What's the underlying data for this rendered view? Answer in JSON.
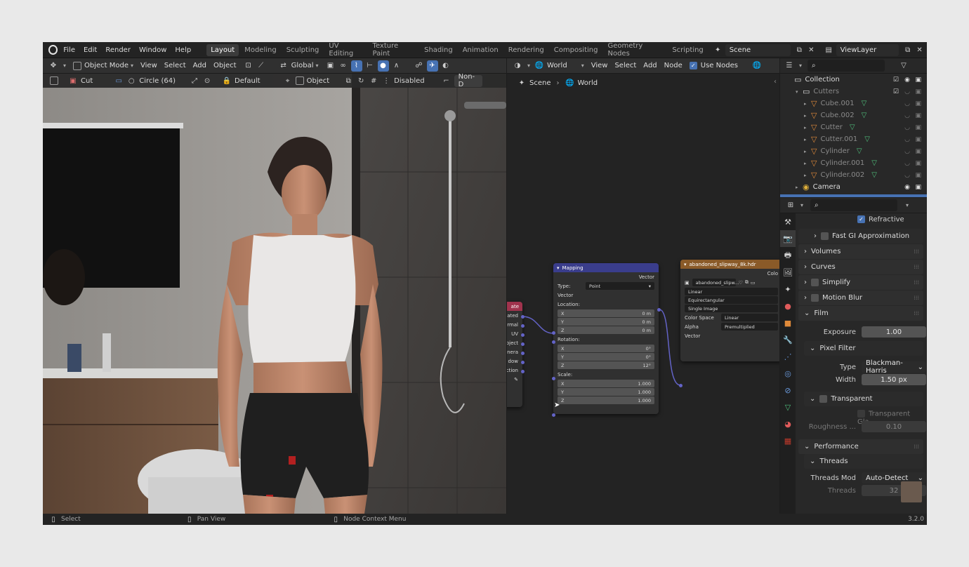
{
  "menu": [
    "File",
    "Edit",
    "Render",
    "Window",
    "Help"
  ],
  "workspaces": [
    {
      "label": "Layout",
      "active": true
    },
    {
      "label": "Modeling"
    },
    {
      "label": "Sculpting"
    },
    {
      "label": "UV Editing"
    },
    {
      "label": "Texture Paint"
    },
    {
      "label": "Shading"
    },
    {
      "label": "Animation"
    },
    {
      "label": "Rendering"
    },
    {
      "label": "Compositing"
    },
    {
      "label": "Geometry Nodes"
    },
    {
      "label": "Scripting"
    }
  ],
  "scene_name": "Scene",
  "view_layer": "ViewLayer",
  "viewport_header": {
    "mode": "Object Mode",
    "view": "View",
    "select": "Select",
    "add": "Add",
    "object": "Object",
    "transform_orientation": "Global"
  },
  "tool_settings": {
    "tool": "Cut",
    "shape": "Circle (64)",
    "layer": "Default",
    "operand": "Object",
    "solver": "Disabled",
    "extra": "Non-D"
  },
  "node_editor": {
    "shader_type": "World",
    "view": "View",
    "select": "Select",
    "add": "Add",
    "node": "Node",
    "use_nodes": "Use Nodes",
    "breadcrumb": [
      "Scene",
      "World"
    ],
    "left_node": {
      "title": "ate",
      "outputs": [
        "ated",
        "rmal",
        "UV",
        "bject",
        "nera",
        "dow",
        "ction"
      ]
    },
    "mapping": {
      "title": "Mapping",
      "output": "Vector",
      "type_label": "Type:",
      "type_value": "Point",
      "vector_input": "Vector",
      "location_label": "Location:",
      "location": [
        {
          "a": "X",
          "v": "0 m"
        },
        {
          "a": "Y",
          "v": "0 m"
        },
        {
          "a": "Z",
          "v": "0 m"
        }
      ],
      "rotation_label": "Rotation:",
      "rotation": [
        {
          "a": "X",
          "v": "0°"
        },
        {
          "a": "Y",
          "v": "0°"
        },
        {
          "a": "Z",
          "v": "12°"
        }
      ],
      "scale_label": "Scale:",
      "scale": [
        {
          "a": "X",
          "v": "1.000"
        },
        {
          "a": "Y",
          "v": "1.000"
        },
        {
          "a": "Z",
          "v": "1.000"
        }
      ]
    },
    "env": {
      "title": "abandoned_slipway_8k.hdr",
      "output": "Colo",
      "image": "abandoned_slipw...",
      "interpolation": "Linear",
      "projection": "Equirectangular",
      "source": "Single Image",
      "colorspace_label": "Color Space",
      "colorspace": "Linear",
      "alpha_label": "Alpha",
      "alpha": "Premultiplied",
      "vector_input": "Vector"
    }
  },
  "outliner": {
    "rows": [
      {
        "name": "Collection",
        "indent": 0,
        "icon": "collection"
      },
      {
        "name": "Cutters",
        "indent": 1,
        "icon": "collection",
        "dim": true
      },
      {
        "name": "Cube.001",
        "indent": 2,
        "icon": "mesh",
        "dim": true
      },
      {
        "name": "Cube.002",
        "indent": 2,
        "icon": "mesh",
        "dim": true
      },
      {
        "name": "Cutter",
        "indent": 2,
        "icon": "mesh",
        "dim": true
      },
      {
        "name": "Cutter.001",
        "indent": 2,
        "icon": "mesh",
        "dim": true
      },
      {
        "name": "Cylinder",
        "indent": 2,
        "icon": "mesh",
        "dim": true
      },
      {
        "name": "Cylinder.001",
        "indent": 2,
        "icon": "mesh",
        "dim": true
      },
      {
        "name": "Cylinder.002",
        "indent": 2,
        "icon": "mesh",
        "dim": true
      },
      {
        "name": "Camera",
        "indent": 1,
        "icon": "camera"
      }
    ]
  },
  "properties": {
    "refractive": "Refractive",
    "fast_gi": "Fast GI Approximation",
    "volumes": "Volumes",
    "curves": "Curves",
    "simplify": "Simplify",
    "motion_blur": "Motion Blur",
    "film": "Film",
    "exposure_label": "Exposure",
    "exposure": "1.00",
    "pixel_filter": "Pixel Filter",
    "type_label": "Type",
    "type_value": "Blackman-Harris",
    "width_label": "Width",
    "width_value": "1.50 px",
    "transparent": "Transparent",
    "transparent_glass": "Transparent Gla...",
    "roughness_label": "Roughness ...",
    "roughness": "0.10",
    "performance": "Performance",
    "threads": "Threads",
    "threads_mode_label": "Threads Mod",
    "threads_mode": "Auto-Detect",
    "threads_count_label": "Threads",
    "threads_count": "32"
  },
  "status": {
    "select": "Select",
    "pan": "Pan View",
    "context": "Node Context Menu",
    "version": "3.2.0"
  }
}
